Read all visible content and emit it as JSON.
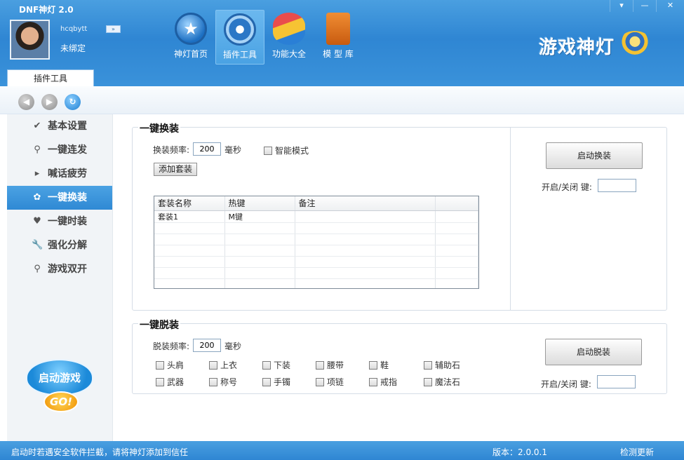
{
  "window": {
    "title": "DNF神灯 2.0",
    "controls": {
      "menu": "▾",
      "minimize": "—",
      "close": "✕"
    }
  },
  "user": {
    "name": "hcqbytt",
    "expand_label": "»",
    "bind_status": "未绑定"
  },
  "nav": [
    {
      "label": "神灯首页",
      "icon": "star-icon"
    },
    {
      "label": "插件工具",
      "icon": "plugin-gear-icon",
      "active": true
    },
    {
      "label": "功能大全",
      "icon": "function-disc-icon"
    },
    {
      "label": "模 型 库",
      "icon": "model-vest-icon"
    }
  ],
  "brand": {
    "text": "游戏神灯",
    "icon": "magic-lamp-icon"
  },
  "tab": {
    "label": "插件工具"
  },
  "toolbar": {
    "back": "◀",
    "forward": "▶",
    "refresh": "↻"
  },
  "sidebar": {
    "items": [
      {
        "label": "基本设置",
        "icon": "✔"
      },
      {
        "label": "一键连发",
        "icon": "⚲"
      },
      {
        "label": "喊话疲劳",
        "icon": "▸"
      },
      {
        "label": "一键换装",
        "icon": "✿",
        "active": true
      },
      {
        "label": "一键时装",
        "icon": "♥"
      },
      {
        "label": "强化分解",
        "icon": "🔧"
      },
      {
        "label": "游戏双开",
        "icon": "⚲"
      }
    ],
    "start_game": {
      "label": "启动游戏",
      "go": "GO!"
    }
  },
  "equip_panel": {
    "title": "一键换装",
    "freq_label": "换装频率:",
    "freq_value": "200",
    "freq_unit": "毫秒",
    "smart_mode": "智能模式",
    "add_button": "添加套装",
    "table": {
      "headers": [
        "套装名称",
        "热键",
        "备注",
        ""
      ],
      "rows": [
        [
          "套装1",
          "M键",
          "",
          ""
        ],
        [
          "",
          "",
          "",
          ""
        ],
        [
          "",
          "",
          "",
          ""
        ],
        [
          "",
          "",
          "",
          ""
        ],
        [
          "",
          "",
          "",
          ""
        ],
        [
          "",
          "",
          "",
          ""
        ],
        [
          "",
          "",
          "",
          ""
        ]
      ]
    },
    "start_button": "启动换装",
    "toggle_label": "开启/关闭 键:",
    "toggle_value": ""
  },
  "unequip_panel": {
    "title": "一键脱装",
    "freq_label": "脱装频率:",
    "freq_value": "200",
    "freq_unit": "毫秒",
    "slots": [
      "头肩",
      "上衣",
      "下装",
      "腰带",
      "鞋",
      "辅助石",
      "武器",
      "称号",
      "手镯",
      "项链",
      "戒指",
      "魔法石"
    ],
    "start_button": "启动脱装",
    "toggle_label": "开启/关闭 键:",
    "toggle_value": ""
  },
  "status": {
    "message": "启动时若遇安全软件拦截，请将神灯添加到信任",
    "version": "版本：2.0.0.1",
    "update": "检测更新"
  }
}
